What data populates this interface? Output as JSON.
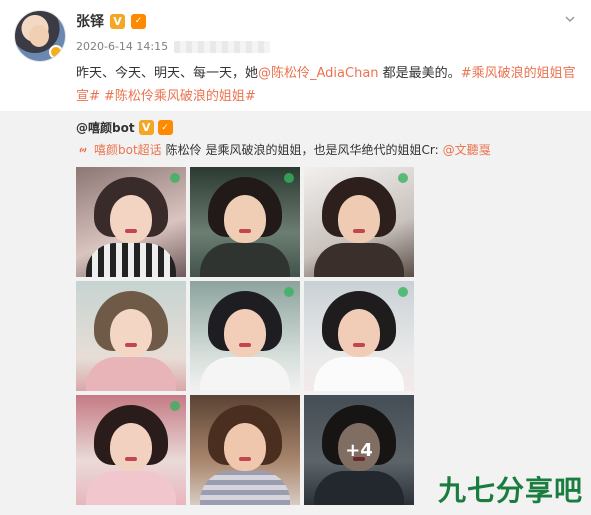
{
  "post": {
    "username": "张铎",
    "vip_badge": "V",
    "level_badge": "✓",
    "timestamp": "2020-6-14 14:15",
    "text_prefix": "昨天、今天、明天、每一天，她",
    "mention": "@陈松伶_AdiaChan",
    "text_middle": " 都是最美的。",
    "tag1": "#乘风破浪的姐姐官宣#",
    "tag2": " #陈松伶乘风破浪的姐姐#"
  },
  "repost": {
    "username": "@嘻颜bot",
    "vip_badge": "V",
    "level_badge": "✓",
    "super_topic": "嘻颜bot超话",
    "text": " 陈松伶 是乘风破浪的姐姐，也是风华绝代的姐姐Cr:",
    "credit": "@文聽戛",
    "more_count": "+4"
  },
  "icons": {
    "menu": "chevron-down-icon",
    "link": "link-icon"
  },
  "colors": {
    "link": "#eb7350",
    "repost_bg": "#f2f2f2",
    "watermark": "#1a7c3e"
  },
  "watermark": "九七分享吧"
}
